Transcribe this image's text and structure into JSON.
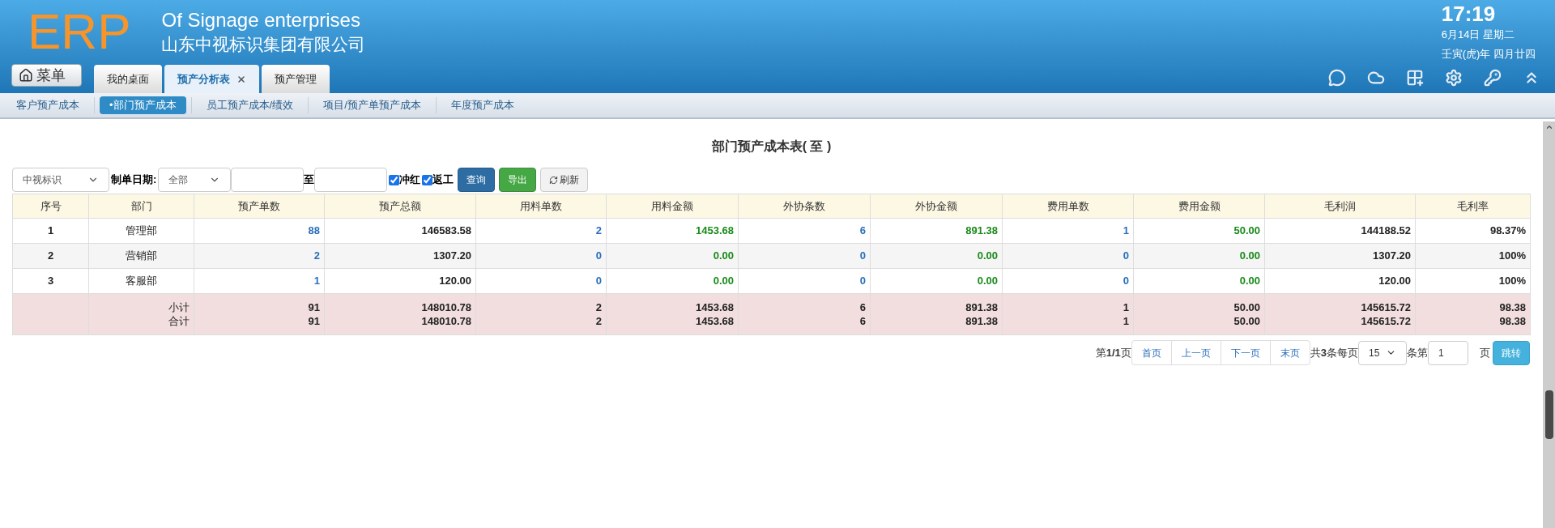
{
  "header": {
    "logo": "ERP",
    "title_en": "Of Signage enterprises",
    "title_cn": "山东中视标识集团有限公司",
    "time": "17:19",
    "date": "6月14日 星期二",
    "lunar": "壬寅(虎)年 四月廿四",
    "menu_button": "菜单"
  },
  "tabs": [
    {
      "label": "我的桌面",
      "selected": false,
      "closable": false
    },
    {
      "label": "预产分析表",
      "selected": true,
      "closable": true
    },
    {
      "label": "预产管理",
      "selected": false,
      "closable": false
    }
  ],
  "subnav": [
    {
      "label": "客户预产成本",
      "selected": false
    },
    {
      "label": "•部门预产成本",
      "selected": true
    },
    {
      "label": "员工预产成本/绩效",
      "selected": false
    },
    {
      "label": "项目/预产单预产成本",
      "selected": false
    },
    {
      "label": "年度预产成本",
      "selected": false
    }
  ],
  "report_title": "部门预产成本表( 至 )",
  "filters": {
    "company": "中视标识",
    "date_label": "制单日期:",
    "date_range": "全部",
    "to_label": "至",
    "checkboxes": [
      {
        "label": "冲红",
        "checked": true
      },
      {
        "label": "返工",
        "checked": true
      }
    ],
    "buttons": [
      {
        "label": "查询",
        "kind": "primary"
      },
      {
        "label": "导出",
        "kind": "success"
      },
      {
        "label": "刷新",
        "kind": "refresh"
      }
    ]
  },
  "table": {
    "columns": [
      {
        "label": "序号",
        "kind": "index"
      },
      {
        "label": "部门",
        "kind": "name"
      },
      {
        "label": "预产单数",
        "kind": "count"
      },
      {
        "label": "预产总额",
        "kind": "plain"
      },
      {
        "label": "用料单数",
        "kind": "count"
      },
      {
        "label": "用料金额",
        "kind": "amount"
      },
      {
        "label": "外协条数",
        "kind": "count"
      },
      {
        "label": "外协金额",
        "kind": "amount"
      },
      {
        "label": "费用单数",
        "kind": "count"
      },
      {
        "label": "费用金额",
        "kind": "amount"
      },
      {
        "label": "毛利润",
        "kind": "plain"
      },
      {
        "label": "毛利率",
        "kind": "plain"
      }
    ],
    "rows": [
      [
        "1",
        "管理部",
        "88",
        "146583.58",
        "2",
        "1453.68",
        "6",
        "891.38",
        "1",
        "50.00",
        "144188.52",
        "98.37%"
      ],
      [
        "2",
        "营销部",
        "2",
        "1307.20",
        "0",
        "0.00",
        "0",
        "0.00",
        "0",
        "0.00",
        "1307.20",
        "100%"
      ],
      [
        "3",
        "客服部",
        "1",
        "120.00",
        "0",
        "0.00",
        "0",
        "0.00",
        "0",
        "0.00",
        "120.00",
        "100%"
      ]
    ],
    "totals": [
      [
        "小计",
        "91",
        "148010.78",
        "2",
        "1453.68",
        "6",
        "891.38",
        "1",
        "50.00",
        "145615.72",
        "98.38"
      ],
      [
        "合计",
        "91",
        "148010.78",
        "2",
        "1453.68",
        "6",
        "891.38",
        "1",
        "50.00",
        "145615.72",
        "98.38"
      ]
    ]
  },
  "pagination": {
    "page_info": "第**1/1**页",
    "links": [
      "首页",
      "上一页",
      "下一页",
      "末页"
    ],
    "count_info": "共**3**条每页",
    "page_size": "15",
    "goto_label": "条第",
    "goto_value": "1",
    "page_label": "页",
    "goto_button": "跳转"
  }
}
